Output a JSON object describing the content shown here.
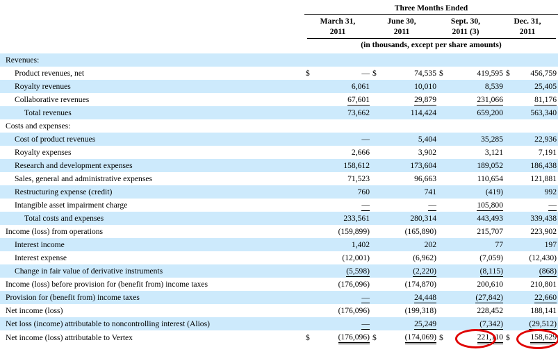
{
  "header": {
    "title": "Three Months Ended",
    "columns": [
      {
        "line1": "March 31,",
        "line2": "2011"
      },
      {
        "line1": "June 30,",
        "line2": "2011"
      },
      {
        "line1": "Sept. 30,",
        "line2": "2011 (3)"
      },
      {
        "line1": "Dec. 31,",
        "line2": "2011"
      }
    ],
    "units": "(in thousands, except per share amounts)"
  },
  "rows": [
    {
      "label": "Revenues:",
      "values": [
        "",
        "",
        "",
        ""
      ]
    },
    {
      "label": "Product revenues, net",
      "values": [
        "—",
        "74,535",
        "419,595",
        "456,759"
      ],
      "dollar": true
    },
    {
      "label": "Royalty revenues",
      "values": [
        "6,061",
        "10,010",
        "8,539",
        "25,405"
      ]
    },
    {
      "label": "Collaborative revenues",
      "values": [
        "67,601",
        "29,879",
        "231,066",
        "81,176"
      ]
    },
    {
      "label": "Total revenues",
      "values": [
        "73,662",
        "114,424",
        "659,200",
        "563,340"
      ]
    },
    {
      "label": "Costs and expenses:",
      "values": [
        "",
        "",
        "",
        ""
      ]
    },
    {
      "label": "Cost of product revenues",
      "values": [
        "—",
        "5,404",
        "35,285",
        "22,936"
      ]
    },
    {
      "label": "Royalty expenses",
      "values": [
        "2,666",
        "3,902",
        "3,121",
        "7,191"
      ]
    },
    {
      "label": "Research and development expenses",
      "values": [
        "158,612",
        "173,604",
        "189,052",
        "186,438"
      ]
    },
    {
      "label": "Sales, general and administrative expenses",
      "values": [
        "71,523",
        "96,663",
        "110,654",
        "121,881"
      ]
    },
    {
      "label": "Restructuring expense (credit)",
      "values": [
        "760",
        "741",
        "(419)",
        "992"
      ]
    },
    {
      "label": "Intangible asset impairment charge",
      "values": [
        "—",
        "—",
        "105,800",
        "—"
      ]
    },
    {
      "label": "Total costs and expenses",
      "values": [
        "233,561",
        "280,314",
        "443,493",
        "339,438"
      ]
    },
    {
      "label": "Income (loss) from operations",
      "values": [
        "(159,899)",
        "(165,890)",
        "215,707",
        "223,902"
      ]
    },
    {
      "label": "Interest income",
      "values": [
        "1,402",
        "202",
        "77",
        "197"
      ]
    },
    {
      "label": "Interest expense",
      "values": [
        "(12,001)",
        "(6,962)",
        "(7,059)",
        "(12,430)"
      ]
    },
    {
      "label": "Change in fair value of derivative instruments",
      "values": [
        "(5,598)",
        "(2,220)",
        "(8,115)",
        "(868)"
      ]
    },
    {
      "label": "Income (loss) before provision for (benefit from) income taxes",
      "values": [
        "(176,096)",
        "(174,870)",
        "200,610",
        "210,801"
      ]
    },
    {
      "label": "Provision for (benefit from) income taxes",
      "values": [
        "—",
        "24,448",
        "(27,842)",
        "22,660"
      ]
    },
    {
      "label": "Net income (loss)",
      "values": [
        "(176,096)",
        "(199,318)",
        "228,452",
        "188,141"
      ]
    },
    {
      "label": "Net loss (income) attributable to noncontrolling interest (Alios)",
      "values": [
        "—",
        "25,249",
        "(7,342)",
        "(29,512)"
      ]
    },
    {
      "label": "Net income (loss) attributable to Vertex",
      "values": [
        "(176,096)",
        "(174,069)",
        "221,110",
        "158,629"
      ],
      "dollar": true
    }
  ],
  "dollar_sign": "$",
  "highlight_color": "#e00000",
  "shade_color": "#cdeafc"
}
